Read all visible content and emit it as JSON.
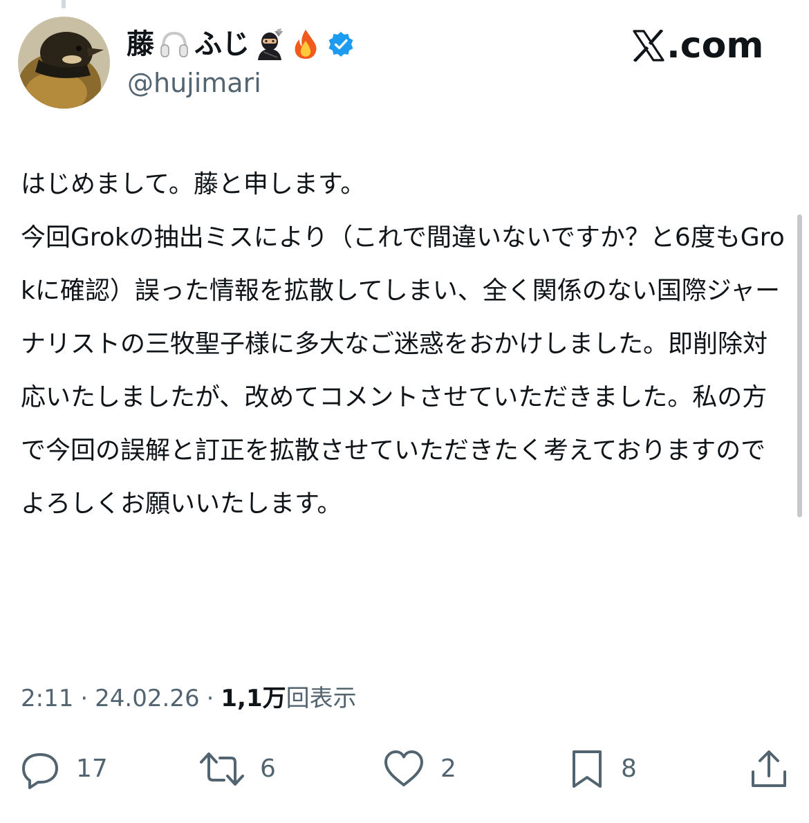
{
  "user": {
    "display_name_prefix": "藤",
    "display_name_mid": "ふじ",
    "handle": "@hujimari",
    "verified": true,
    "name_emojis": [
      "headphones-emoji",
      "ninja-emoji",
      "fire-emoji"
    ]
  },
  "site": {
    "logo_suffix": ".com"
  },
  "tweet": {
    "text": "はじめまして。藤と申します。\n今回Grokの抽出ミスにより（これで間違いないですか？と6度もGrokに確認）誤った情報を拡散してしまい、全く関係のない国際ジャーナリストの三牧聖子様に多大なご迷惑をおかけしました。即削除対応いたしましたが、改めてコメントさせていただきました。私の方で今回の誤解と訂正を拡散させていただきたく考えておりますのでよろしくお願いいたします。",
    "time": "2:11",
    "date": "24.02.26",
    "views_count": "1,1万",
    "views_label": "回表示"
  },
  "actions": {
    "reply_count": "17",
    "retweet_count": "6",
    "like_count": "2",
    "bookmark_count": "8"
  },
  "colors": {
    "text_primary": "#0f1419",
    "text_secondary": "#536471",
    "verified_blue": "#1d9bf0",
    "background": "#ffffff"
  }
}
